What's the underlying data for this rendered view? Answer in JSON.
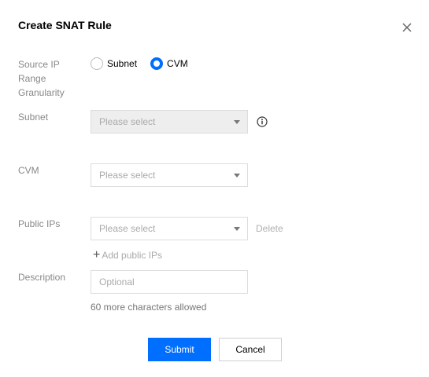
{
  "dialog": {
    "title": "Create SNAT Rule"
  },
  "form": {
    "source_range": {
      "label_lines": [
        "Source IP",
        "Range",
        "Granularity"
      ],
      "options": [
        {
          "label": "Subnet",
          "checked": false
        },
        {
          "label": "CVM",
          "checked": true
        }
      ]
    },
    "subnet": {
      "label": "Subnet",
      "placeholder": "Please select",
      "disabled": true
    },
    "cvm": {
      "label": "CVM",
      "placeholder": "Please select"
    },
    "public_ips": {
      "label": "Public IPs",
      "placeholder": "Please select",
      "delete_label": "Delete",
      "add_label": "Add public IPs"
    },
    "description": {
      "label": "Description",
      "placeholder": "Optional",
      "hint": "60 more characters allowed"
    }
  },
  "actions": {
    "submit_label": "Submit",
    "cancel_label": "Cancel"
  },
  "colors": {
    "primary": "#006eff",
    "disabled_bg": "#eeeeee"
  },
  "icons": [
    "close-icon",
    "info-icon",
    "plus-icon",
    "caret-down-icon"
  ]
}
